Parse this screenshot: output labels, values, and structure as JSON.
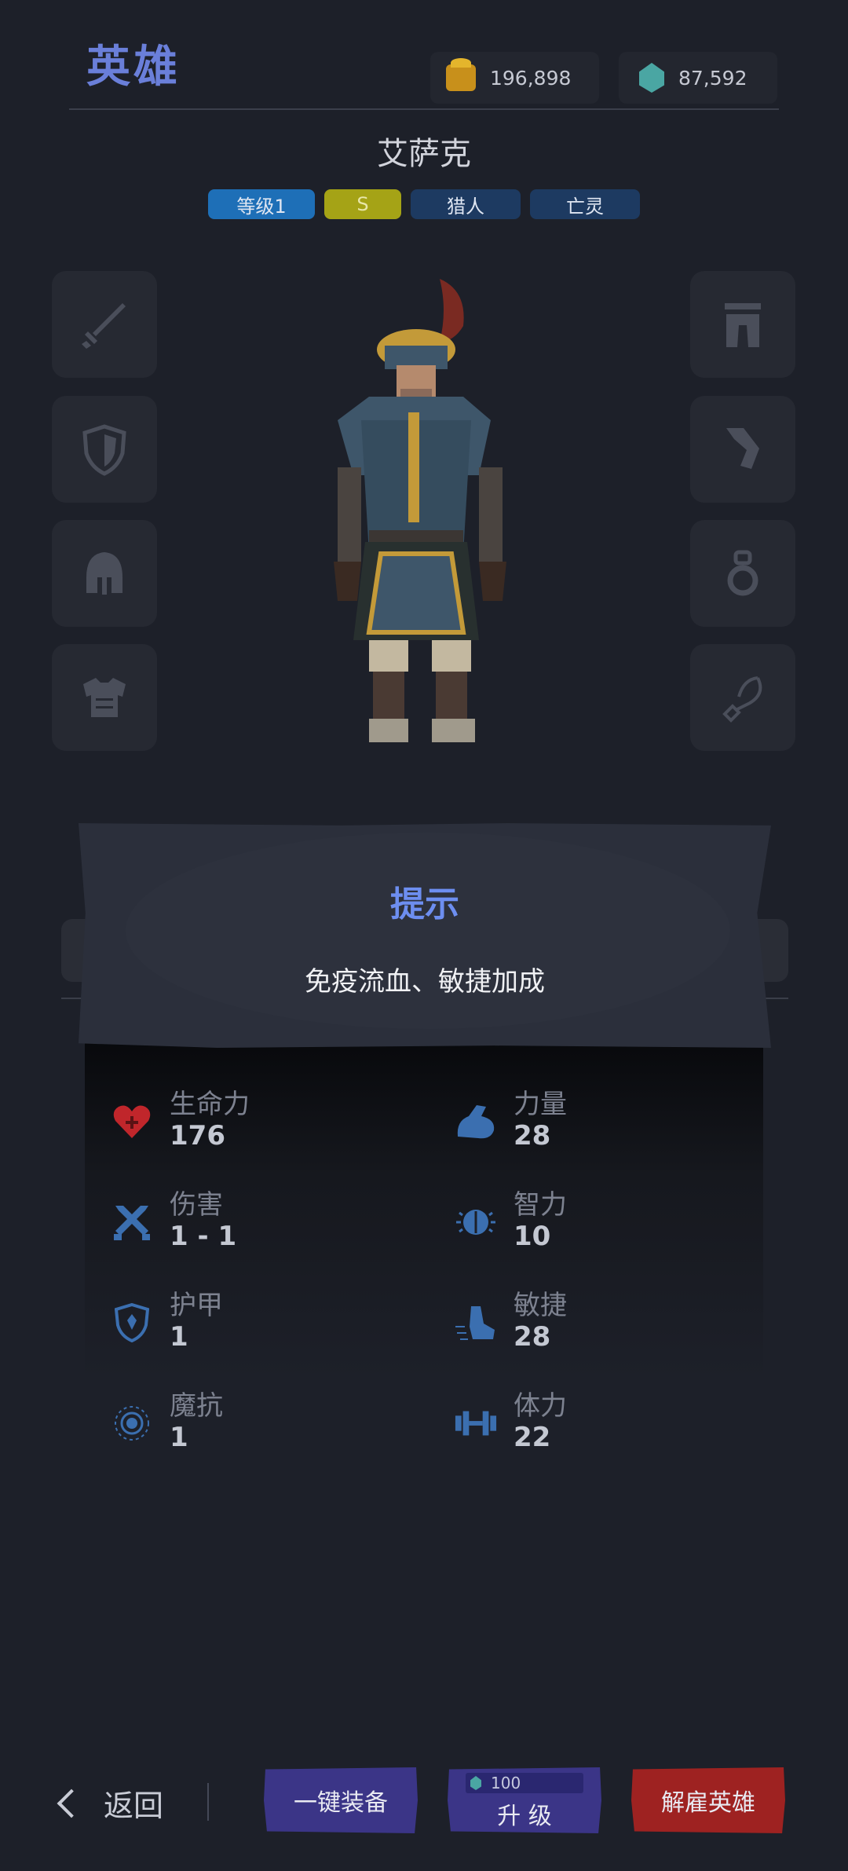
{
  "header": {
    "title": "英雄",
    "gold": "196,898",
    "gems": "87,592"
  },
  "hero": {
    "name": "艾萨克",
    "tags": [
      "等级1",
      "S",
      "猎人",
      "亡灵"
    ]
  },
  "slots": {
    "left": [
      "sword-icon",
      "shield-icon",
      "helmet-icon",
      "armor-icon"
    ],
    "right": [
      "pants-icon",
      "boots-icon",
      "ring-icon",
      "amulet-icon"
    ]
  },
  "tip": {
    "title": "提示",
    "body": "免疫流血、敏捷加成"
  },
  "stats": [
    {
      "label": "生命力",
      "value": "176",
      "icon": "heart-icon"
    },
    {
      "label": "力量",
      "value": "28",
      "icon": "muscle-icon"
    },
    {
      "label": "伤害",
      "value": "1 - 1",
      "icon": "crossed-swords-icon"
    },
    {
      "label": "智力",
      "value": "10",
      "icon": "brain-icon"
    },
    {
      "label": "护甲",
      "value": "1",
      "icon": "shield-icon"
    },
    {
      "label": "敏捷",
      "value": "28",
      "icon": "boot-icon"
    },
    {
      "label": "魔抗",
      "value": "1",
      "icon": "magic-resist-icon"
    },
    {
      "label": "体力",
      "value": "22",
      "icon": "dumbbell-icon"
    }
  ],
  "footer": {
    "back": "返回",
    "equip_all": "一键装备",
    "upgrade_cost": "100",
    "upgrade": "升 级",
    "dismiss": "解雇英雄"
  },
  "colors": {
    "accent": "#6a7fd9",
    "stat_icon": "#3b6fb0",
    "health": "#c0262b"
  }
}
